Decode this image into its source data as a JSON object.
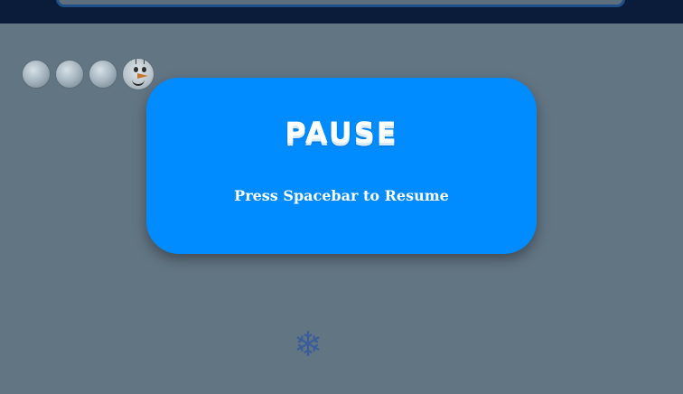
{
  "pause_dialog": {
    "title": "PAUSE",
    "subtitle": "Press Spacebar to Resume"
  },
  "lives": {
    "snowballs": [
      "snowball",
      "snowball",
      "snowball"
    ],
    "character": "olaf-snowman"
  },
  "icons": {
    "falling": "snowflake-icon",
    "snowflake_glyph": "❄"
  },
  "colors": {
    "background": "#627583",
    "top_bar": "#0a1c3a",
    "panel": "#008cff",
    "text": "#ffffff",
    "snowflake": "#3a5d9a"
  }
}
